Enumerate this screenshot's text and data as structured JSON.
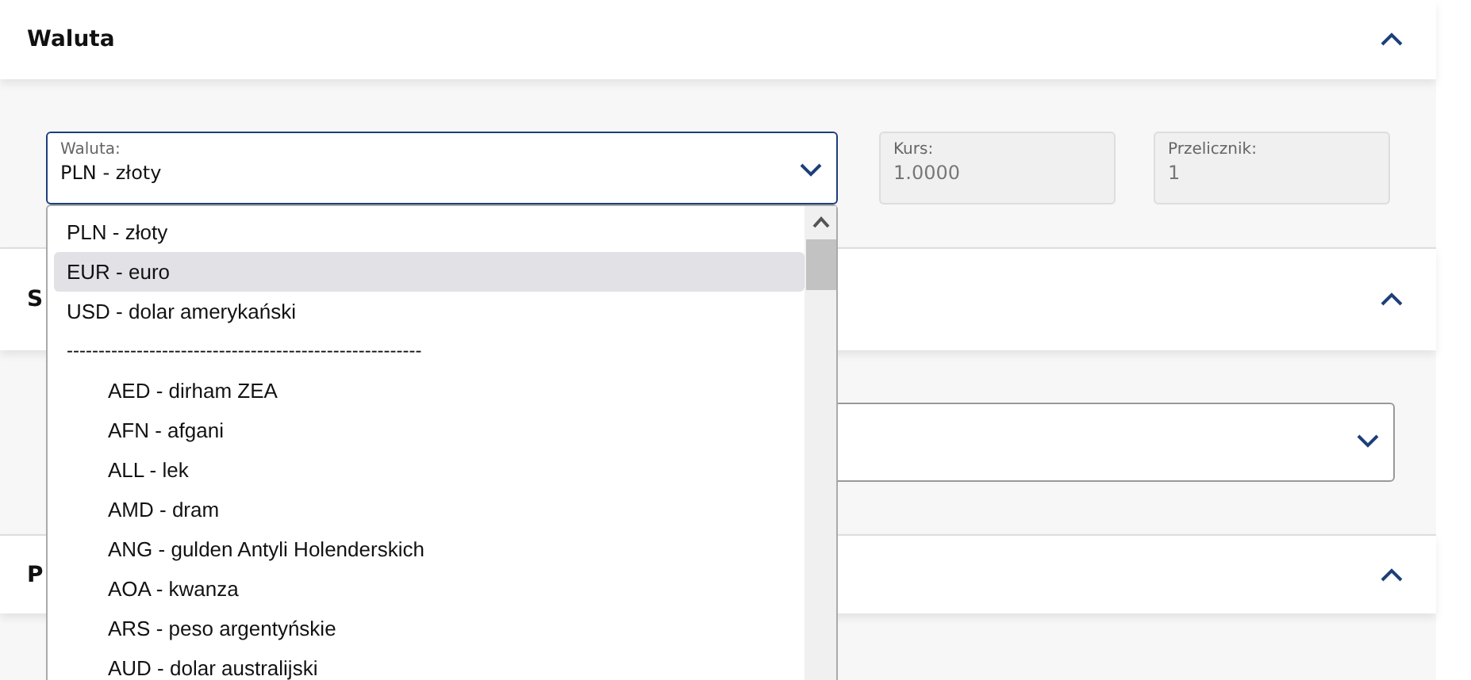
{
  "sections": [
    {
      "title": "Waluta",
      "expanded": true
    },
    {
      "title": "S",
      "expanded": true
    },
    {
      "title": "P",
      "expanded": true
    }
  ],
  "currency_field": {
    "label": "Waluta:",
    "value": "PLN - złoty"
  },
  "rate_field": {
    "label": "Kurs:",
    "value": "1.0000",
    "disabled": true
  },
  "converter_field": {
    "label": "Przelicznik:",
    "value": "1",
    "disabled": true
  },
  "dropdown": {
    "top_options": [
      {
        "label": "PLN - złoty",
        "selected": false
      },
      {
        "label": "EUR - euro",
        "selected": true
      },
      {
        "label": "USD - dolar amerykański",
        "selected": false
      }
    ],
    "separator": "--------------------------------------------------------",
    "currency_options": [
      {
        "label": "AED - dirham ZEA",
        "selected": false
      },
      {
        "label": "AFN - afgani",
        "selected": false
      },
      {
        "label": "ALL - lek",
        "selected": false
      },
      {
        "label": "AMD - dram",
        "selected": false
      },
      {
        "label": "ANG - gulden Antyli Holenderskich",
        "selected": false
      },
      {
        "label": "AOA - kwanza",
        "selected": false
      },
      {
        "label": "ARS - peso argentyńskie",
        "selected": false
      },
      {
        "label": "AUD - dolar australijski",
        "selected": false
      }
    ]
  }
}
